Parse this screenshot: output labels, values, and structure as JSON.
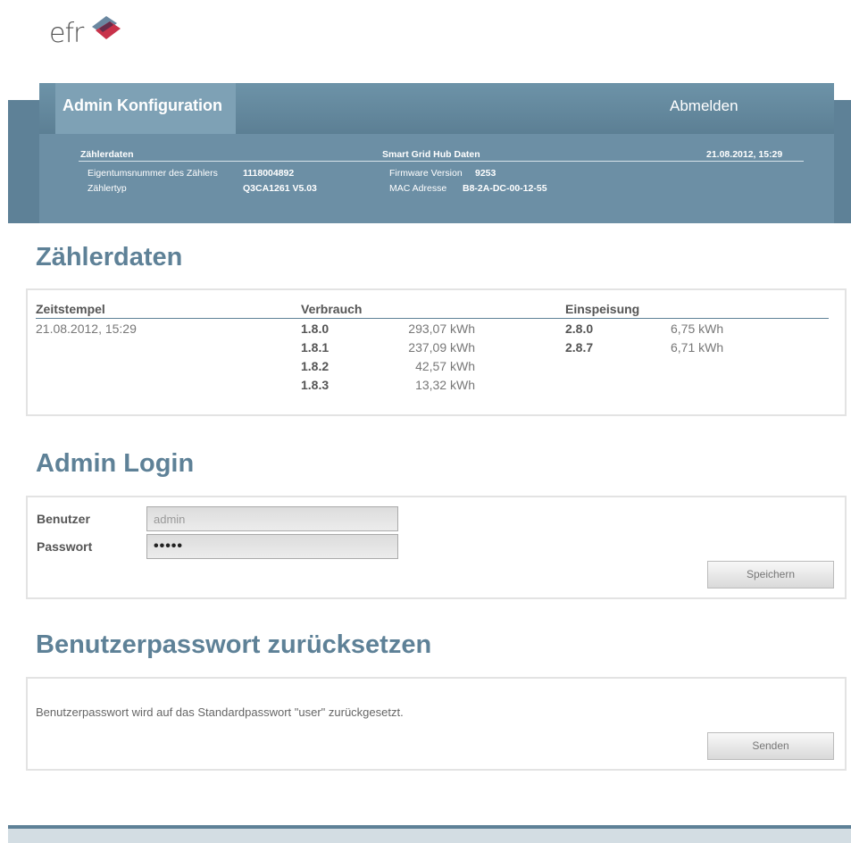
{
  "logo": {
    "text": "efr"
  },
  "nav": {
    "title": "Admin Konfiguration",
    "logout": "Abmelden"
  },
  "info": {
    "meter_heading": "Zählerdaten",
    "hub_heading": "Smart Grid Hub Daten",
    "datetime": "21.08.2012, 15:29",
    "ownership_label": "Eigentumsnummer des Zählers",
    "ownership_value": "1118004892",
    "type_label": "Zählertyp",
    "type_value": "Q3CA1261 V5.03",
    "firmware_label": "Firmware Version",
    "firmware_value": "9253",
    "mac_label": "MAC Adresse",
    "mac_value": "B8-2A-DC-00-12-55"
  },
  "meter": {
    "title": "Zählerdaten",
    "col_timestamp": "Zeitstempel",
    "col_consumption": "Verbrauch",
    "col_feed": "Einspeisung",
    "timestamp": "21.08.2012, 15:29",
    "consumption": [
      {
        "code": "1.8.0",
        "value": "293,07 kWh"
      },
      {
        "code": "1.8.1",
        "value": "237,09 kWh"
      },
      {
        "code": "1.8.2",
        "value": "42,57 kWh"
      },
      {
        "code": "1.8.3",
        "value": "13,32 kWh"
      }
    ],
    "feed": [
      {
        "code": "2.8.0",
        "value": "6,75 kWh"
      },
      {
        "code": "2.8.7",
        "value": "6,71 kWh"
      }
    ]
  },
  "login": {
    "title": "Admin Login",
    "user_label": "Benutzer",
    "user_value": "admin",
    "password_label": "Passwort",
    "password_value": "•••••",
    "save_button": "Speichern"
  },
  "reset": {
    "title": "Benutzerpasswort zurücksetzen",
    "description": "Benutzerpasswort wird auf das Standardpasswort \"user\" zurückgesetzt.",
    "send_button": "Senden"
  },
  "colors": {
    "accent": "#5e8197",
    "header_bg": "#6c8fa5",
    "active_tab": "#7ea1b5"
  }
}
